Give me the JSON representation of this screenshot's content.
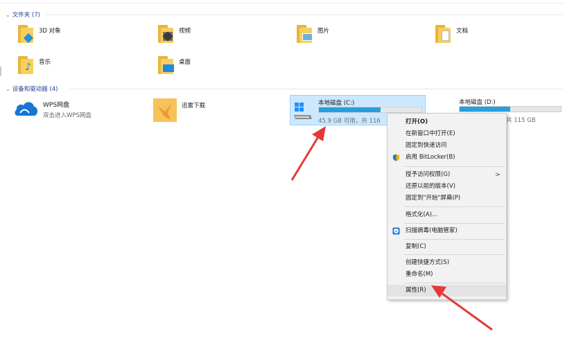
{
  "groups": {
    "folders": {
      "title": "文件夹 (7)"
    },
    "devices": {
      "title": "设备和驱动器 (4)"
    }
  },
  "folders": [
    {
      "label": "3D 对象",
      "icon": "3d-objects-folder-icon"
    },
    {
      "label": "视频",
      "icon": "video-folder-icon"
    },
    {
      "label": "图片",
      "icon": "pictures-folder-icon"
    },
    {
      "label": "文档",
      "icon": "documents-folder-icon"
    },
    {
      "label": "音乐",
      "icon": "music-folder-icon"
    },
    {
      "label": "桌面",
      "icon": "desktop-folder-icon"
    }
  ],
  "devices": {
    "wps": {
      "name": "WPS网盘",
      "subtitle": "双击进入WPS网盘"
    },
    "xunlei": {
      "name": "迅雷下载"
    },
    "drive_c": {
      "name": "本地磁盘 (C:)",
      "free_text": "45.9 GB 可用，共 116",
      "used_fraction": 0.6
    },
    "drive_d": {
      "name": "本地磁盘 (D:)",
      "free_text": "共 115 GB",
      "used_fraction": 0.5
    }
  },
  "context_menu": {
    "items": [
      {
        "label": "打开(O)",
        "bold": true
      },
      {
        "label": "在新窗口中打开(E)"
      },
      {
        "label": "固定到快速访问"
      },
      {
        "label": "启用 BitLocker(B)",
        "icon": "shield-icon"
      },
      {
        "label": "授予访问权限(G)",
        "submenu": true,
        "arrow": ">"
      },
      {
        "label": "还原以前的版本(V)"
      },
      {
        "label": "固定到\"开始\"屏幕(P)"
      },
      {
        "label": "格式化(A)..."
      },
      {
        "label": "扫描病毒(电脑管家)",
        "icon": "tencent-pc-manager-icon"
      },
      {
        "label": "复制(C)"
      },
      {
        "label": "创建快捷方式(S)"
      },
      {
        "label": "重命名(M)"
      },
      {
        "label": "属性(R)",
        "hover": true
      }
    ]
  },
  "colors": {
    "accent": "#26a0da",
    "selection": "#cce8ff",
    "annotation": "#e53935",
    "folder": "#f7cf5a"
  }
}
